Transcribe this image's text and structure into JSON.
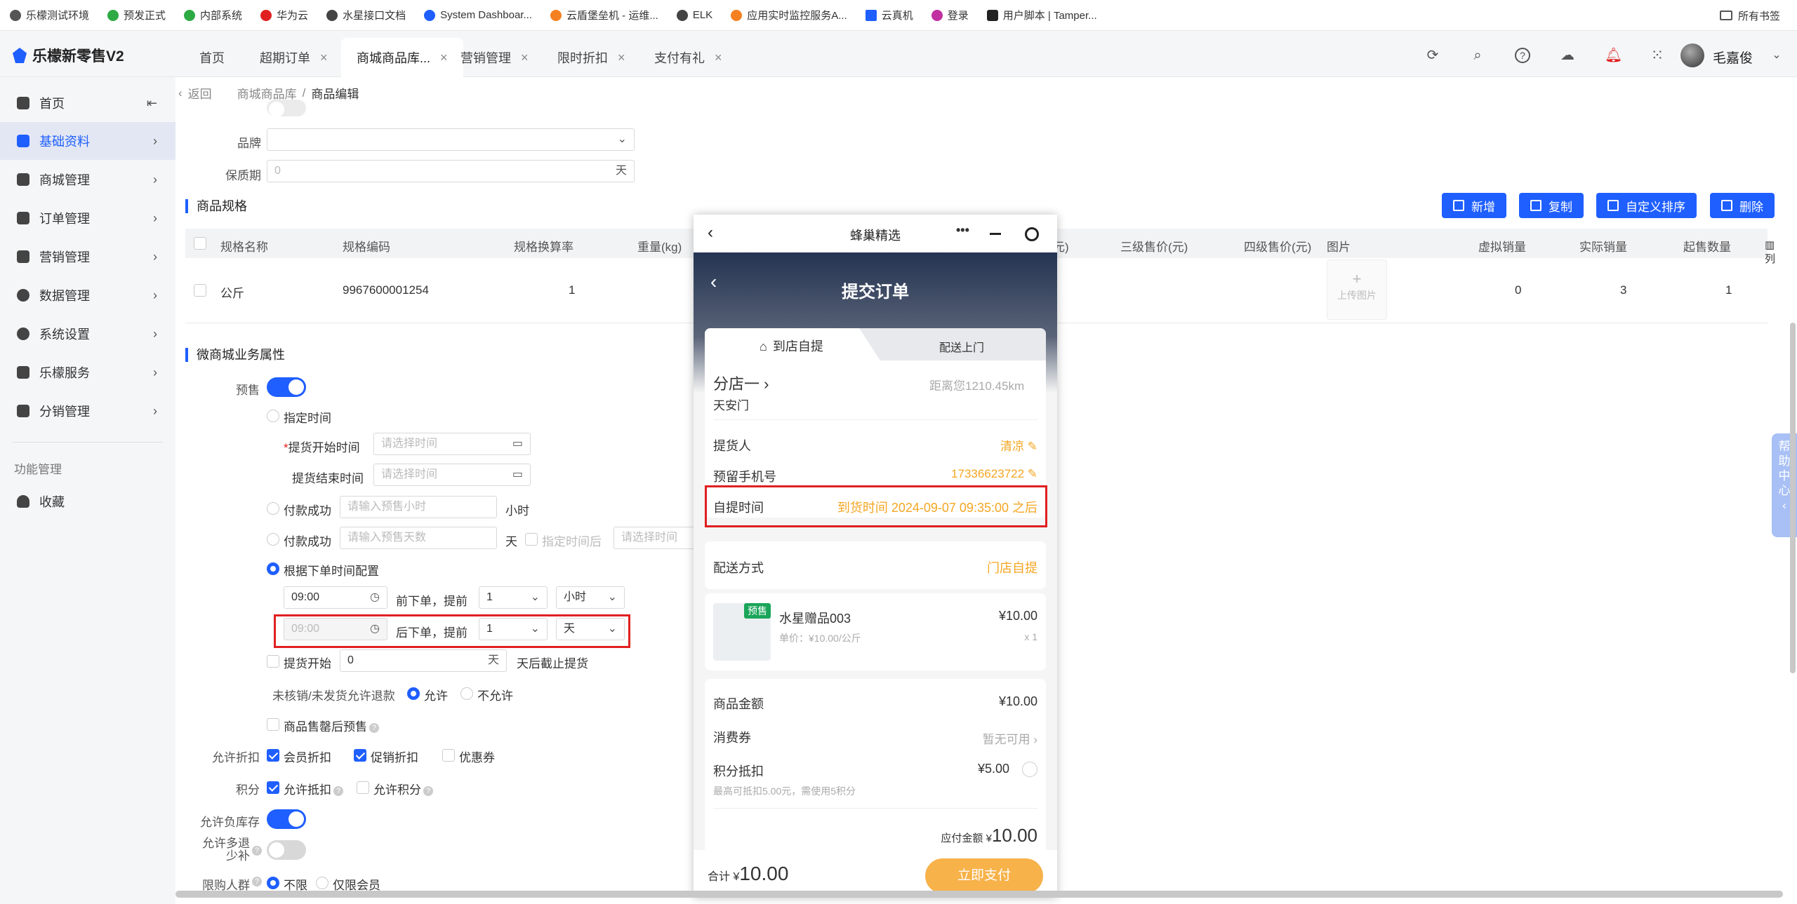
{
  "bookmarks": [
    {
      "label": "乐檬测试环境",
      "color": "#555"
    },
    {
      "label": "预发正式",
      "color": "#2eaa44"
    },
    {
      "label": "内部系统",
      "color": "#2eaa44"
    },
    {
      "label": "华为云",
      "color": "#e02020"
    },
    {
      "label": "水星接口文档",
      "color": "#444"
    },
    {
      "label": "System Dashboar...",
      "color": "#1f5fff"
    },
    {
      "label": "云盾堡垒机 - 运维...",
      "color": "#f58020"
    },
    {
      "label": "ELK",
      "color": "#444"
    },
    {
      "label": "应用实时监控服务A...",
      "color": "#f58020"
    },
    {
      "label": "云真机",
      "color": "#1f5fff"
    },
    {
      "label": "登录",
      "color": "#c030a0"
    },
    {
      "label": "用户脚本 | Tamper...",
      "color": "#222"
    }
  ],
  "bookmarks_all": "所有书签",
  "app": {
    "title": "乐檬新零售V2",
    "user": "毛嘉俊"
  },
  "tabs": [
    {
      "label": "首页",
      "closable": false
    },
    {
      "label": "超期订单",
      "closable": true
    },
    {
      "label": "商城商品库...",
      "closable": true,
      "active": true
    },
    {
      "label": "营销管理",
      "closable": true
    },
    {
      "label": "限时折扣",
      "closable": true
    },
    {
      "label": "支付有礼",
      "closable": true
    }
  ],
  "sidebar": {
    "items": [
      {
        "label": "首页",
        "collapse": "⇤"
      },
      {
        "label": "基础资料",
        "active": true
      },
      {
        "label": "商城管理"
      },
      {
        "label": "订单管理"
      },
      {
        "label": "营销管理"
      },
      {
        "label": "数据管理"
      },
      {
        "label": "系统设置"
      },
      {
        "label": "乐檬服务"
      },
      {
        "label": "分销管理"
      }
    ],
    "section": "功能管理",
    "favorites": "收藏"
  },
  "breadcrumb": {
    "back": "返回",
    "parent": "商城商品库",
    "sep": "/",
    "current": "商品编辑"
  },
  "form": {
    "brand_label": "品牌",
    "shelf_life_label": "保质期",
    "shelf_life_value": "0",
    "shelf_life_unit": "天",
    "spec_title": "商品规格",
    "buttons": [
      "新增",
      "复制",
      "自定义排序",
      "删除"
    ],
    "columns": [
      "规格名称",
      "规格编码",
      "规格换算率",
      "重量(kg)",
      "元)",
      "三级售价(元)",
      "四级售价(元)",
      "图片",
      "虚拟销量",
      "实际销量",
      "起售数量"
    ],
    "col_setting": "列",
    "row": {
      "name": "公斤",
      "code": "9967600001254",
      "rate": "1",
      "upload": "上传图片",
      "virtual": "0",
      "actual": "3",
      "min": "1"
    },
    "biz_title": "微商城业务属性",
    "presale_label": "预售",
    "opt_fixed_time": "指定时间",
    "pickup_start_label": "提货开始时间",
    "pickup_end_label": "提货结束时间",
    "time_placeholder": "请选择时间",
    "pay_success": "付款成功",
    "hours_placeholder": "请输入预售小时",
    "hours_unit": "小时",
    "days_placeholder": "请输入预售天数",
    "days_unit": "天",
    "after_fixed": "指定时间后",
    "opt_by_order": "根据下单时间配置",
    "time1": "09:00",
    "before_text": "前下单，提前",
    "sel1": "1",
    "unit1": "小时",
    "time2_placeholder": "09:00",
    "after_text": "后下单，提前",
    "sel2": "1",
    "unit2": "天",
    "pickup_start_opt": "提货开始",
    "pickup_days": "0",
    "pickup_days_unit": "天",
    "pickup_after": "天后截止提货",
    "refund_label": "未核销/未发货允许退款",
    "allow": "允许",
    "disallow": "不允许",
    "sold_out_presale": "商品售罄后预售",
    "discount_label": "允许折扣",
    "member_discount": "会员折扣",
    "promo_discount": "促销折扣",
    "coupon": "优惠券",
    "points_label": "积分",
    "allow_deduct": "允许抵扣",
    "allow_points": "允许积分",
    "negative_stock": "允许负库存",
    "over_refund_l1": "允许多退",
    "over_refund_l2": "少补",
    "limit_label": "限购人群",
    "unlimited": "不限",
    "members_only": "仅限会员"
  },
  "phone": {
    "app_name": "蜂巢精选",
    "page_title": "提交订单",
    "tab_pickup": "到店自提",
    "tab_delivery": "配送上门",
    "store": "分店一 ›",
    "distance": "距离您1210.45km",
    "address": "天安门",
    "picker_label": "提货人",
    "picker_value": "清凉 ✎",
    "phone_label": "预留手机号",
    "phone_value": "17336623722 ✎",
    "pickup_time_label": "自提时间",
    "pickup_time_value": "到货时间 2024-09-07 09:35:00 之后",
    "delivery_label": "配送方式",
    "delivery_value": "门店自提",
    "badge": "预售",
    "product_name": "水星赠品003",
    "product_price": "¥10.00",
    "unit_price": "单价：¥10.00/公斤",
    "qty": "x 1",
    "amount_label": "商品金额",
    "amount_value": "¥10.00",
    "coupon_label": "消费券",
    "coupon_value": "暂无可用 ›",
    "points_label": "积分抵扣",
    "points_value": "¥5.00",
    "points_note": "最高可抵扣5.00元，需使用5积分",
    "payable_label": "应付金额 ¥",
    "payable_value": "10.00",
    "total_label": "合计 ¥",
    "total_value": "10.00",
    "pay_button": "立即支付"
  },
  "help": [
    "帮",
    "助",
    "中",
    "心",
    "‹"
  ]
}
